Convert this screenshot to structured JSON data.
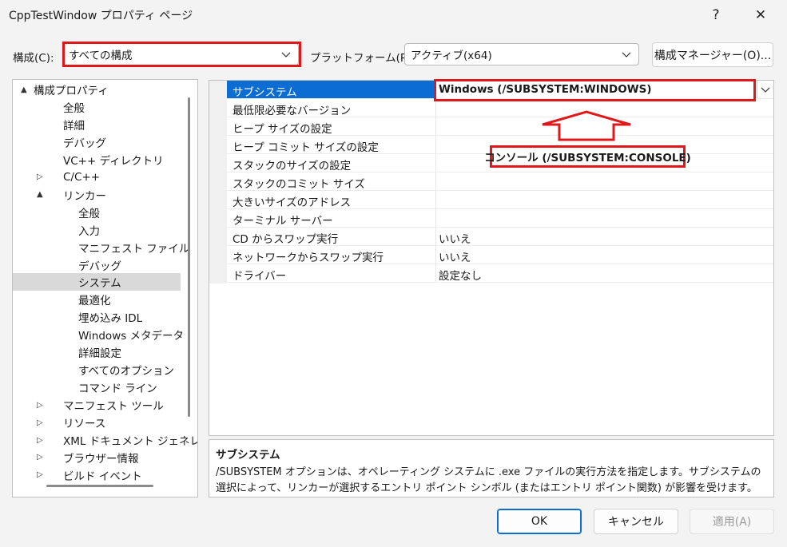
{
  "window": {
    "title": "CppTestWindow プロパティ ページ",
    "help": "?",
    "close": "✕"
  },
  "toolbar": {
    "config_label": "構成(C):",
    "config_value": "すべての構成",
    "platform_label": "プラットフォーム(P):",
    "platform_value": "アクティブ(x64)",
    "config_manager": "構成マネージャー(O)..."
  },
  "tree": [
    {
      "label": "構成プロパティ",
      "level": 0,
      "arrow": "▲"
    },
    {
      "label": "全般",
      "level": 1
    },
    {
      "label": "詳細",
      "level": 1
    },
    {
      "label": "デバッグ",
      "level": 1
    },
    {
      "label": "VC++ ディレクトリ",
      "level": 1
    },
    {
      "label": "C/C++",
      "level": 1,
      "arrow": "▷"
    },
    {
      "label": "リンカー",
      "level": 1,
      "arrow": "▲"
    },
    {
      "label": "全般",
      "level": 2
    },
    {
      "label": "入力",
      "level": 2
    },
    {
      "label": "マニフェスト ファイル",
      "level": 2
    },
    {
      "label": "デバッグ",
      "level": 2
    },
    {
      "label": "システム",
      "level": 2,
      "selected": true
    },
    {
      "label": "最適化",
      "level": 2
    },
    {
      "label": "埋め込み IDL",
      "level": 2
    },
    {
      "label": "Windows メタデータ",
      "level": 2
    },
    {
      "label": "詳細設定",
      "level": 2
    },
    {
      "label": "すべてのオプション",
      "level": 2
    },
    {
      "label": "コマンド ライン",
      "level": 2
    },
    {
      "label": "マニフェスト ツール",
      "level": 1,
      "arrow": "▷"
    },
    {
      "label": "リソース",
      "level": 1,
      "arrow": "▷"
    },
    {
      "label": "XML ドキュメント ジェネレータ",
      "level": 1,
      "arrow": "▷"
    },
    {
      "label": "ブラウザー情報",
      "level": 1,
      "arrow": "▷"
    },
    {
      "label": "ビルド イベント",
      "level": 1,
      "arrow": "▷"
    }
  ],
  "grid": {
    "rows": [
      {
        "name": "サブシステム",
        "value": "Windows (/SUBSYSTEM:WINDOWS)",
        "selected": true
      },
      {
        "name": "最低限必要なバージョン",
        "value": ""
      },
      {
        "name": "ヒープ サイズの設定",
        "value": ""
      },
      {
        "name": "ヒープ コミット サイズの設定",
        "value": ""
      },
      {
        "name": "スタックのサイズの設定",
        "value": ""
      },
      {
        "name": "スタックのコミット サイズ",
        "value": ""
      },
      {
        "name": "大きいサイズのアドレス",
        "value": ""
      },
      {
        "name": "ターミナル サーバー",
        "value": ""
      },
      {
        "name": "CD からスワップ実行",
        "value": "いいえ"
      },
      {
        "name": "ネットワークからスワップ実行",
        "value": "いいえ"
      },
      {
        "name": "ドライバー",
        "value": "設定なし"
      }
    ]
  },
  "annotation": {
    "label": "コンソール (/SUBSYSTEM:CONSOLE)",
    "color": "#e0181c"
  },
  "description": {
    "title": "サブシステム",
    "text": "/SUBSYSTEM オプションは、オペレーティング システムに .exe ファイルの実行方法を指定します。サブシステムの選択によって、リンカーが選択するエントリ ポイント シンボル (またはエントリ ポイント関数) が影響を受けます。"
  },
  "buttons": {
    "ok": "OK",
    "cancel": "キャンセル",
    "apply": "適用(A)"
  }
}
